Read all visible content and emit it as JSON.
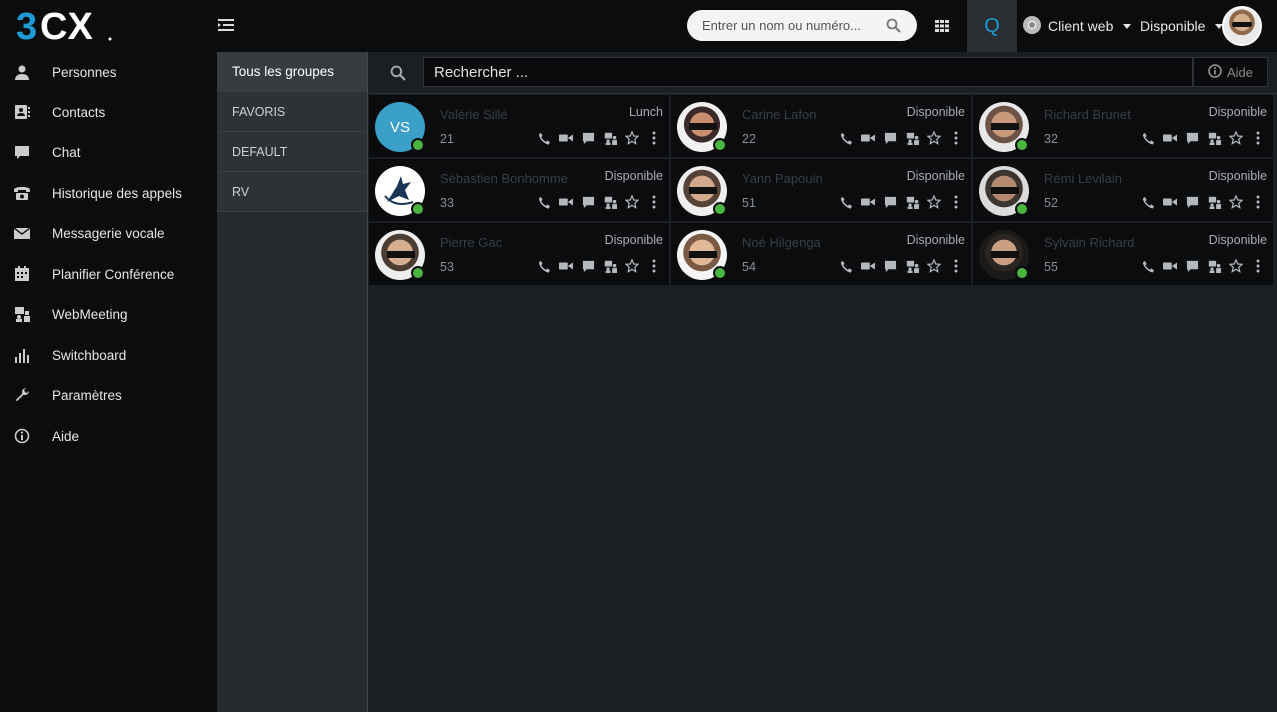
{
  "brand": {
    "logo_text": "3CX",
    "accent": "#1e9bd7"
  },
  "topbar": {
    "search_placeholder": "Entrer un nom ou numéro...",
    "queue_label": "Q",
    "client_label": "Client web",
    "status_label": "Disponible"
  },
  "sidebar": {
    "items": [
      {
        "label": "Personnes",
        "icon": "person-icon"
      },
      {
        "label": "Contacts",
        "icon": "contacts-icon"
      },
      {
        "label": "Chat",
        "icon": "chat-icon"
      },
      {
        "label": "Historique des appels",
        "icon": "phone-history-icon"
      },
      {
        "label": "Messagerie vocale",
        "icon": "envelope-icon"
      },
      {
        "label": "Planifier Conférence",
        "icon": "calendar-icon"
      },
      {
        "label": "WebMeeting",
        "icon": "webmeeting-icon"
      },
      {
        "label": "Switchboard",
        "icon": "bar-chart-icon"
      },
      {
        "label": "Paramètres",
        "icon": "wrench-icon"
      },
      {
        "label": "Aide",
        "icon": "info-icon"
      }
    ]
  },
  "groups": {
    "items": [
      "Tous les groupes",
      "FAVORIS",
      "DEFAULT",
      "RV"
    ]
  },
  "main": {
    "search_placeholder": "Rechercher ...",
    "help_label": "Aide"
  },
  "contacts": [
    {
      "name": "Valérie Sillé",
      "ext": "21",
      "status": "Lunch",
      "initials": "VS",
      "avatar": "initials"
    },
    {
      "name": "Carine Lafon",
      "ext": "22",
      "status": "Disponible",
      "avatar": "photo"
    },
    {
      "name": "Richard Brunet",
      "ext": "32",
      "status": "Disponible",
      "avatar": "photo"
    },
    {
      "name": "Sébastien Bonhomme",
      "ext": "33",
      "status": "Disponible",
      "avatar": "logo"
    },
    {
      "name": "Yann Papouin",
      "ext": "51",
      "status": "Disponible",
      "avatar": "photo"
    },
    {
      "name": "Rémi Levilain",
      "ext": "52",
      "status": "Disponible",
      "avatar": "photo"
    },
    {
      "name": "Pierre Gac",
      "ext": "53",
      "status": "Disponible",
      "avatar": "photo"
    },
    {
      "name": "Noé Hilgenga",
      "ext": "54",
      "status": "Disponible",
      "avatar": "photo"
    },
    {
      "name": "Sylvain Richard",
      "ext": "55",
      "status": "Disponible",
      "avatar": "photo"
    }
  ],
  "colors": {
    "presence_available": "#4ab53f",
    "initials_bg": "#3aa0c8"
  }
}
